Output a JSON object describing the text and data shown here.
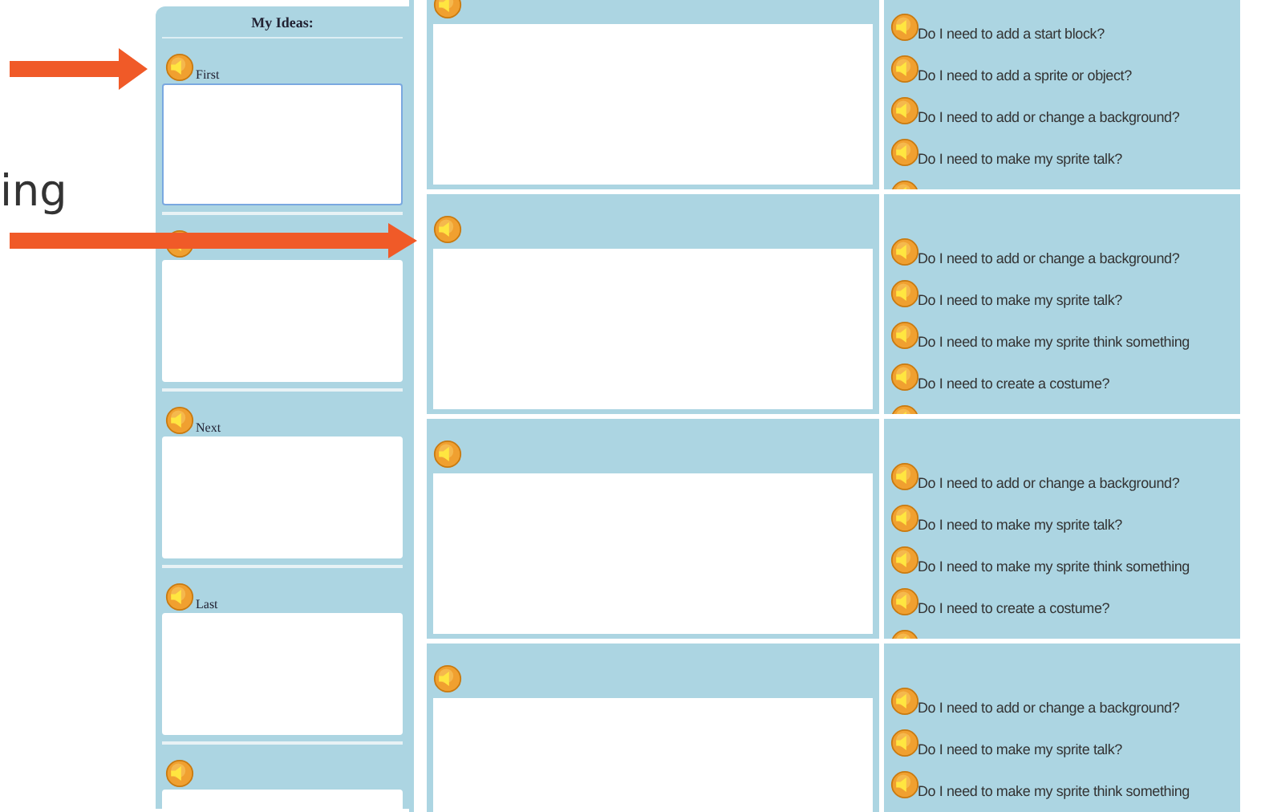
{
  "slide_text": "ing",
  "ideas_panel": {
    "title": "My Ideas:",
    "sections": [
      {
        "label": "First",
        "focused": true
      },
      {
        "focused": false
      },
      {
        "label": "Next",
        "focused": false
      },
      {
        "label": "Last",
        "focused": false
      },
      {
        "focused": false
      }
    ]
  },
  "rows": [
    {
      "questions": [
        "Do I need to add a start block?",
        "Do I need to add a sprite or object?",
        "Do I need to add or change a background?",
        "Do I need to make my sprite talk?"
      ]
    },
    {
      "questions": [
        "Do I need to add or change a background?",
        "Do I need to make my sprite talk?",
        "Do I need to make my sprite think something",
        "Do I need to create a costume?"
      ]
    },
    {
      "questions": [
        "Do I need to add or change a background?",
        "Do I need to make my sprite talk?",
        "Do I need to make my sprite think something",
        "Do I need to create a costume?"
      ]
    },
    {
      "questions": [
        "Do I need to add or change a background?",
        "Do I need to make my sprite talk?",
        "Do I need to make my sprite think something"
      ]
    }
  ]
}
